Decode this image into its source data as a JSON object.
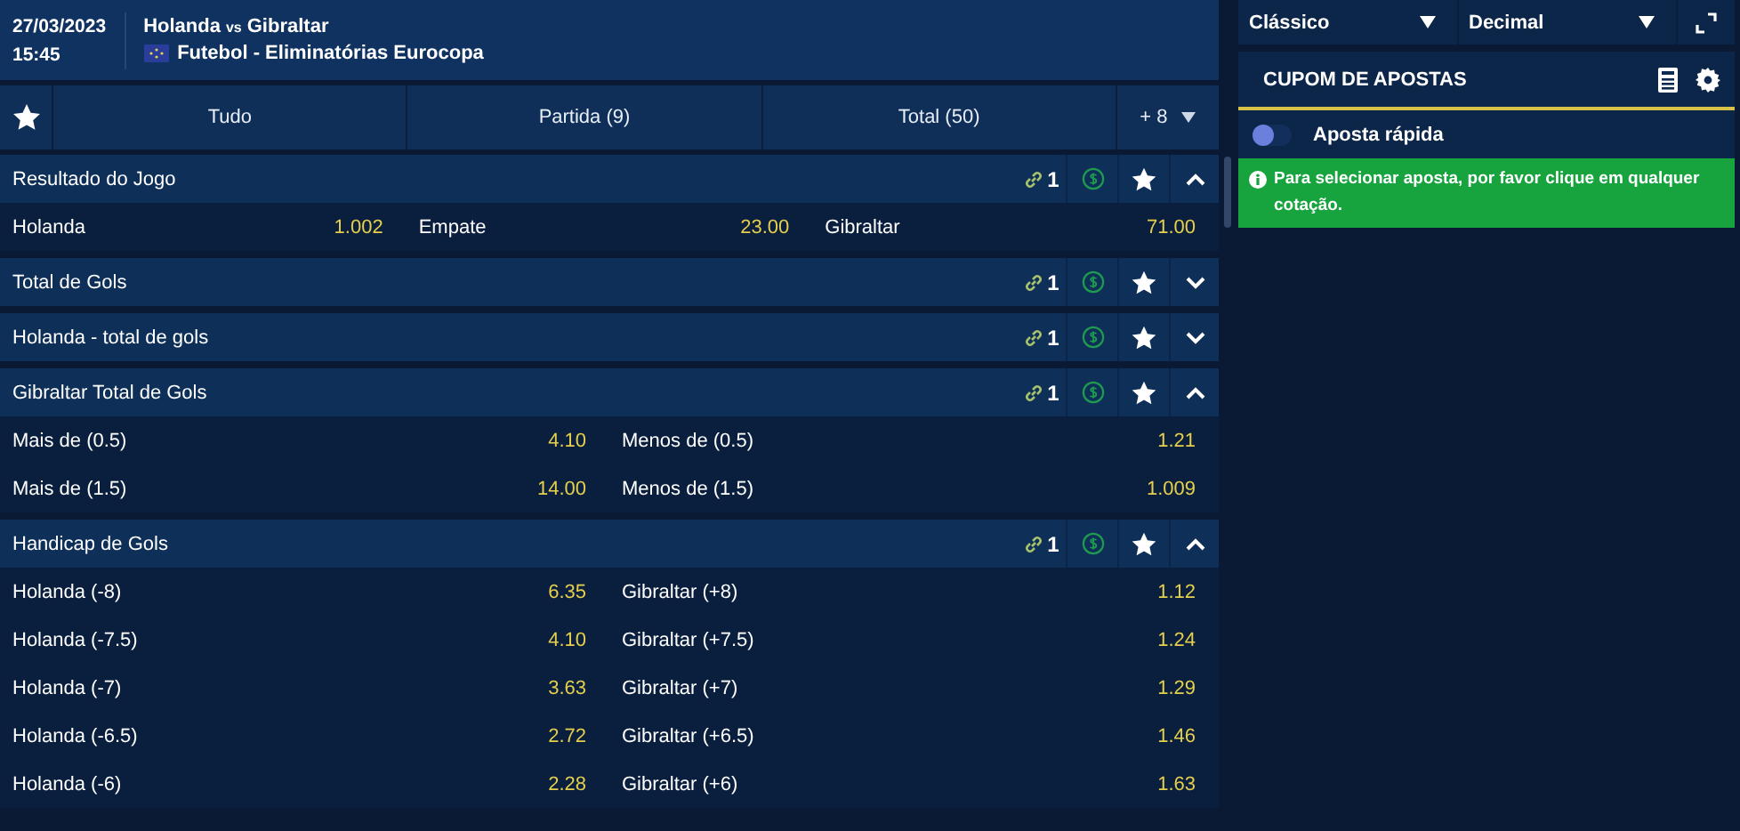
{
  "event": {
    "date": "27/03/2023",
    "time": "15:45",
    "home": "Holanda",
    "vs": "vs",
    "away": "Gibraltar",
    "competition": "Futebol - Eliminatórias Eurocopa"
  },
  "tabs": [
    {
      "label": "Tudo"
    },
    {
      "label": "Partida (9)"
    },
    {
      "label": "Total (50)"
    },
    {
      "label": "+ 8"
    }
  ],
  "markets": [
    {
      "title": "Resultado do Jogo",
      "links": "1",
      "expanded": true,
      "rows": [
        [
          {
            "label": "Holanda",
            "odds": "1.002"
          },
          {
            "label": "Empate",
            "odds": "23.00"
          },
          {
            "label": "Gibraltar",
            "odds": "71.00"
          }
        ]
      ]
    },
    {
      "title": "Total de Gols",
      "links": "1",
      "expanded": false
    },
    {
      "title": "Holanda - total de gols",
      "links": "1",
      "expanded": false
    },
    {
      "title": "Gibraltar Total de Gols",
      "links": "1",
      "expanded": true,
      "rows": [
        [
          {
            "label": "Mais de (0.5)",
            "odds": "4.10"
          },
          {
            "label": "Menos de (0.5)",
            "odds": "1.21"
          }
        ],
        [
          {
            "label": "Mais de (1.5)",
            "odds": "14.00"
          },
          {
            "label": "Menos de (1.5)",
            "odds": "1.009"
          }
        ]
      ]
    },
    {
      "title": "Handicap de Gols",
      "links": "1",
      "expanded": true,
      "rows": [
        [
          {
            "label": "Holanda (-8)",
            "odds": "6.35"
          },
          {
            "label": "Gibraltar (+8)",
            "odds": "1.12"
          }
        ],
        [
          {
            "label": "Holanda (-7.5)",
            "odds": "4.10"
          },
          {
            "label": "Gibraltar (+7.5)",
            "odds": "1.24"
          }
        ],
        [
          {
            "label": "Holanda (-7)",
            "odds": "3.63"
          },
          {
            "label": "Gibraltar (+7)",
            "odds": "1.29"
          }
        ],
        [
          {
            "label": "Holanda (-6.5)",
            "odds": "2.72"
          },
          {
            "label": "Gibraltar (+6.5)",
            "odds": "1.46"
          }
        ],
        [
          {
            "label": "Holanda (-6)",
            "odds": "2.28"
          },
          {
            "label": "Gibraltar (+6)",
            "odds": "1.63"
          }
        ]
      ]
    }
  ],
  "selects": [
    {
      "value": "Clássico"
    },
    {
      "value": "Decimal"
    }
  ],
  "betslip": {
    "title": "CUPOM DE APOSTAS",
    "quick_bet": {
      "label": "Aposta rápida",
      "on": false
    },
    "notice": "Para selecionar aposta, por favor clique em qualquer cotação."
  }
}
